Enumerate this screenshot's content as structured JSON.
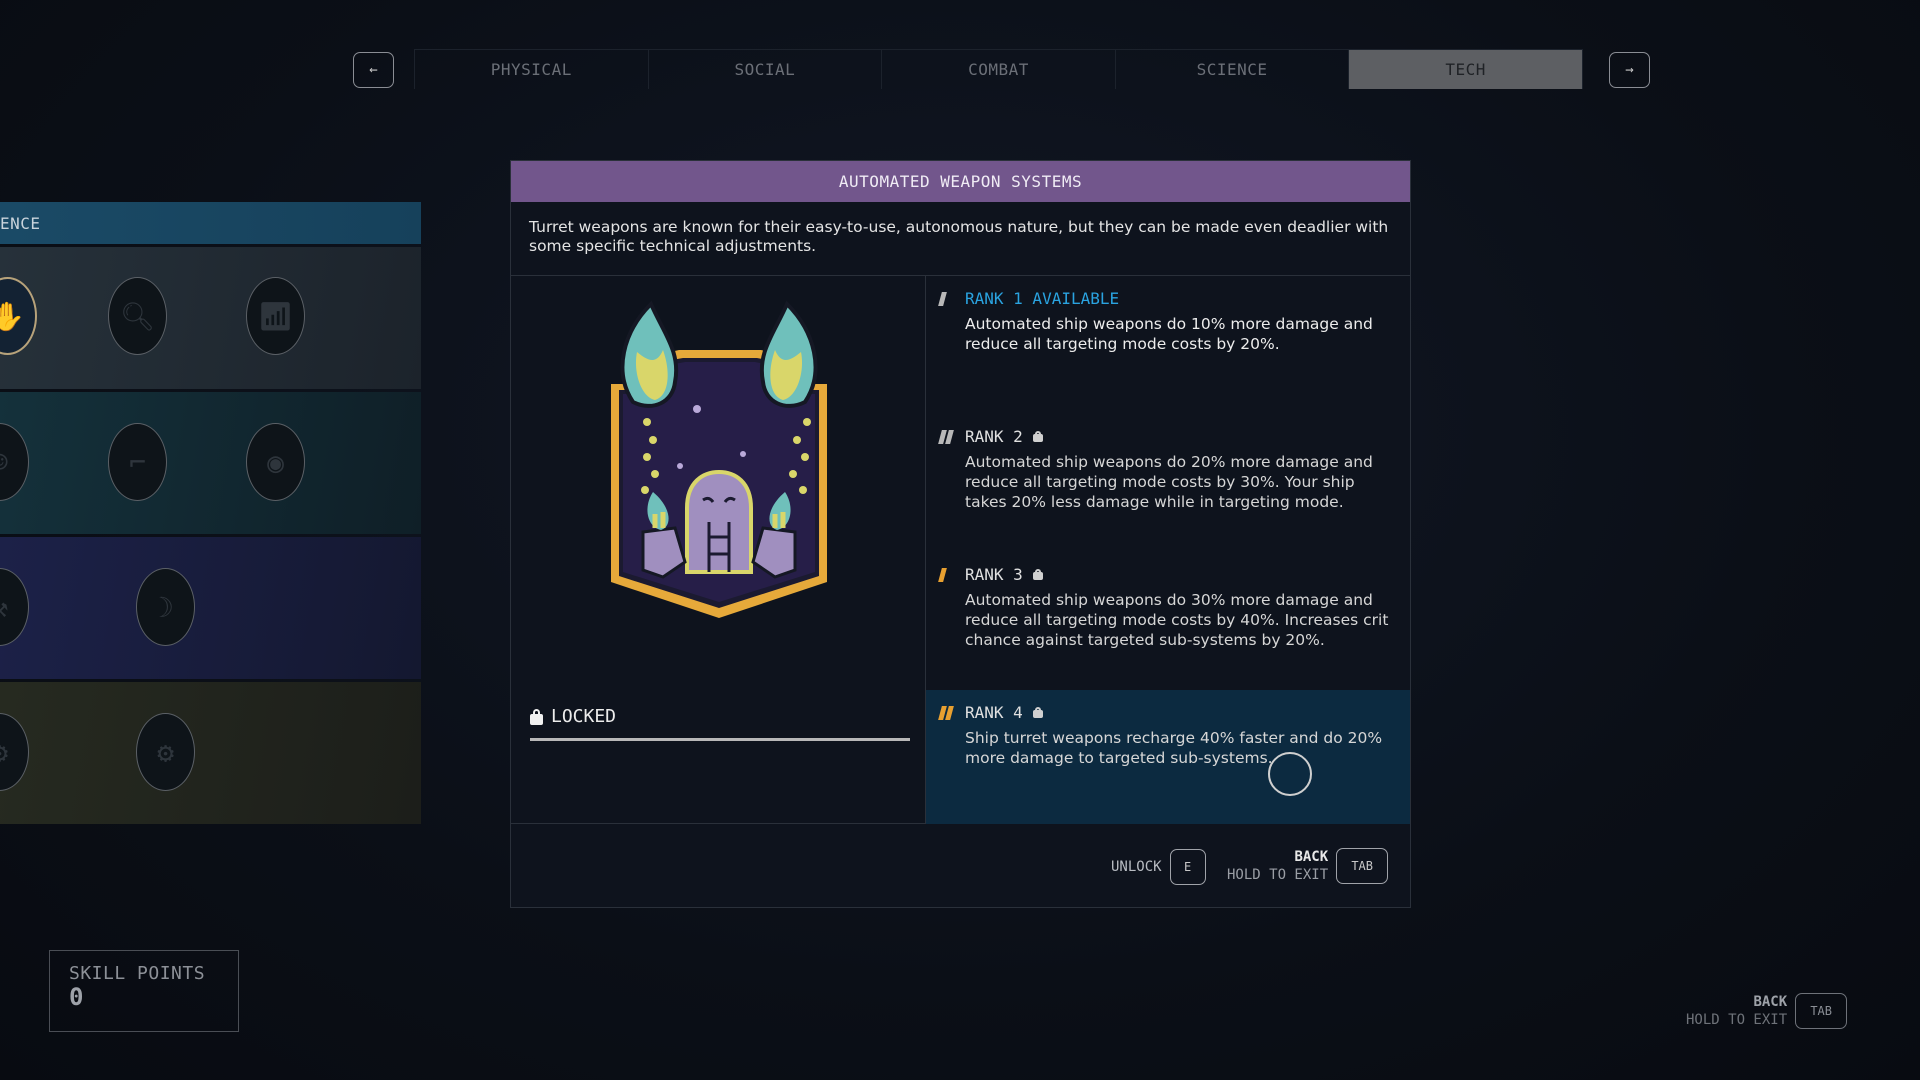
{
  "nav": {
    "prev_icon": "arrow-left-icon",
    "prev_glyph": "←",
    "next_icon": "arrow-right-icon",
    "next_glyph": "→",
    "tabs": [
      {
        "label": "PHYSICAL",
        "active": false
      },
      {
        "label": "SOCIAL",
        "active": false
      },
      {
        "label": "COMBAT",
        "active": false
      },
      {
        "label": "SCIENCE",
        "active": false
      },
      {
        "label": "TECH",
        "active": true
      }
    ]
  },
  "sidebar": {
    "header": "ENCE",
    "rows": [
      {
        "tier": 1,
        "color": "#26313a",
        "skills": [
          "medicine-badge",
          "research-badge",
          "scanner-badge"
        ]
      },
      {
        "tier": 2,
        "color": "#14313b",
        "skills": [
          "astronaut-badge",
          "weapon-schematic-badge",
          "planet-creature-badge"
        ]
      },
      {
        "tier": 3,
        "color": "#1c2148",
        "skills": [
          "tools-badge",
          "planet-explorer-badge"
        ]
      },
      {
        "tier": 4,
        "color": "#262a20",
        "skills": [
          "device-badge",
          "engineering-compass-badge"
        ]
      }
    ]
  },
  "panel": {
    "title": "AUTOMATED WEAPON SYSTEMS",
    "header_color": "#72568c",
    "description": "Turret weapons are known for their easy-to-use, autonomous nature, but they can be made even deadlier with some specific technical adjustments.",
    "status": "LOCKED",
    "progress": 0,
    "ranks": [
      {
        "title": "RANK 1 AVAILABLE",
        "locked": false,
        "available": true,
        "pip_color": "#b8b8b8",
        "pips": 1,
        "description": "Automated ship weapons do 10% more damage and reduce all targeting mode costs by 20%."
      },
      {
        "title": "RANK 2",
        "locked": true,
        "available": false,
        "pip_color": "#b8b8b8",
        "pips": 2,
        "description": "Automated ship weapons do 20% more damage and reduce all targeting mode costs by 30%. Your ship takes 20% less damage while in targeting mode."
      },
      {
        "title": "RANK 3",
        "locked": true,
        "available": false,
        "pip_color": "#e8a030",
        "pips": 1,
        "description": "Automated ship weapons do 30% more damage and reduce all targeting mode costs by 40%. Increases crit chance against targeted sub-systems by 20%."
      },
      {
        "title": "RANK 4",
        "locked": true,
        "available": false,
        "pip_color": "#e8a030",
        "pips": 2,
        "description": "Ship turret weapons recharge 40% faster and do 20% more damage to targeted sub-systems."
      }
    ],
    "footer": {
      "unlock_label": "UNLOCK",
      "unlock_key": "E",
      "back_label": "BACK",
      "exit_label": "HOLD TO EXIT",
      "back_key": "TAB"
    }
  },
  "skill_points": {
    "label": "SKILL POINTS",
    "value": "0"
  },
  "global_hint": {
    "back_label": "BACK",
    "exit_label": "HOLD TO EXIT",
    "key": "TAB"
  }
}
